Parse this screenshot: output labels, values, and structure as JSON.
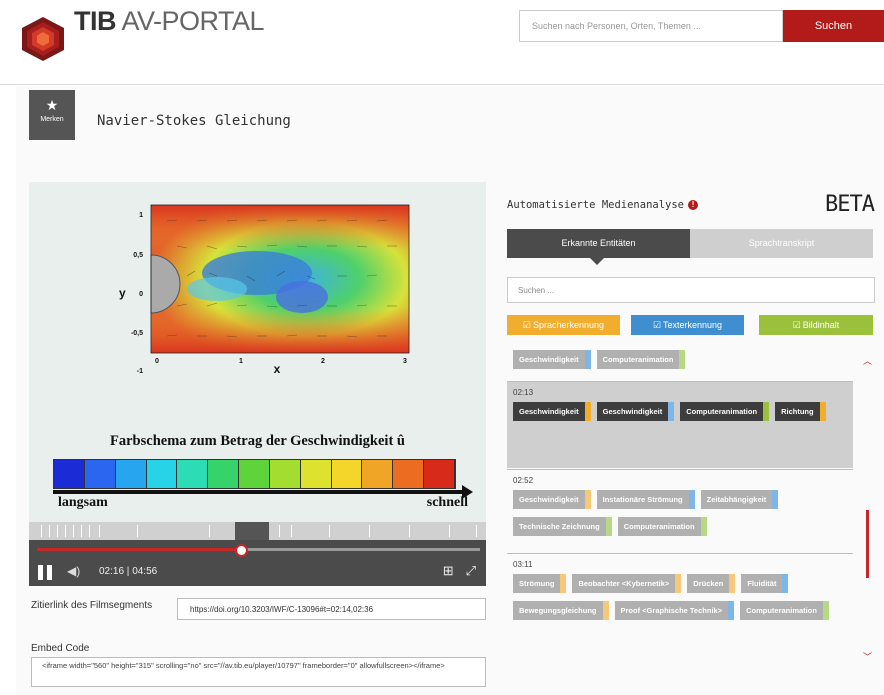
{
  "header": {
    "logo_bold": "TIB",
    "logo_light": "AV-PORTAL",
    "search_placeholder": "Suchen nach Personen, Orten, Themen ...",
    "search_button": "Suchen"
  },
  "page": {
    "merken_label": "Merken",
    "title": "Navier-Stokes Gleichung"
  },
  "video": {
    "plot": {
      "y_label": "y",
      "x_label": "x",
      "y_ticks": [
        "1",
        "0,5",
        "0",
        "-0,5",
        "-1"
      ],
      "x_ticks": [
        "0",
        "1",
        "2",
        "3"
      ]
    },
    "caption": "Farbschema zum Betrag der Geschwindigkeit û",
    "slow_label": "langsam",
    "fast_label": "schnell",
    "colorbar_colors": [
      "#1b2bd6",
      "#2b66f0",
      "#27a6ef",
      "#27d3e6",
      "#2bdcb5",
      "#35d36a",
      "#5fd43a",
      "#a2dd2f",
      "#dde22f",
      "#f4d52a",
      "#f1a526",
      "#ec6c22",
      "#d82a1b"
    ],
    "progress": 0.46,
    "current_time": "02:16",
    "duration": "04:56",
    "time_sep": " | "
  },
  "citation": {
    "label": "Zitierlink des Filmsegments",
    "value": "https://doi.org/10.3203/IWF/C-13096#t=02:14,02:36"
  },
  "embed": {
    "label": "Embed Code",
    "value": "<iframe width=\"560\" height=\"315\" scrolling=\"no\" src=\"//av.tib.eu/player/10797\" frameborder=\"0\" allowfullscreen></iframe>"
  },
  "analysis": {
    "title": "Automatisierte Medienanalyse",
    "beta": "BETA",
    "tabs": [
      "Erkannte Entitäten",
      "Sprachtranskript"
    ],
    "search_placeholder": "Suchen ...",
    "filters": [
      {
        "label": "Spracherkennung",
        "color": "#f0ad2e"
      },
      {
        "label": "Texterkennung",
        "color": "#3f8fd0"
      },
      {
        "label": "Bildinhalt",
        "color": "#9bc13c"
      }
    ],
    "groups": [
      {
        "time": "",
        "highlight": false,
        "tags": [
          {
            "label": "Geschwindigkeit",
            "bar": "#7fb6e8",
            "dark": false
          },
          {
            "label": "Computeranimation",
            "bar": "#b7d983",
            "dark": false
          }
        ]
      },
      {
        "time": "02:13",
        "highlight": true,
        "tags": [
          {
            "label": "Geschwindigkeit",
            "bar": "#f0ad2e",
            "dark": true
          },
          {
            "label": "Geschwindigkeit",
            "bar": "#7fb6e8",
            "dark": true
          },
          {
            "label": "Computeranimation",
            "bar": "#9bc13c",
            "dark": true
          },
          {
            "label": "Richtung",
            "bar": "#f0ad2e",
            "dark": true
          }
        ]
      },
      {
        "time": "02:52",
        "highlight": false,
        "tags": [
          {
            "label": "Geschwindigkeit",
            "bar": "#f5c87a",
            "dark": false
          },
          {
            "label": "Instationäre Strömung",
            "bar": "#7fb6e8",
            "dark": false
          },
          {
            "label": "Zeitabhängigkeit",
            "bar": "#7fb6e8",
            "dark": false
          },
          {
            "label": "Technische Zeichnung",
            "bar": "#b7d983",
            "dark": false
          },
          {
            "label": "Computeranimation",
            "bar": "#b7d983",
            "dark": false
          }
        ]
      },
      {
        "time": "03:11",
        "highlight": false,
        "tags": [
          {
            "label": "Strömung",
            "bar": "#f5c87a",
            "dark": false
          },
          {
            "label": "Beobachter <Kybernetik>",
            "bar": "#f5c87a",
            "dark": false
          },
          {
            "label": "Drücken",
            "bar": "#f5c87a",
            "dark": false
          },
          {
            "label": "Fluidität",
            "bar": "#7fb6e8",
            "dark": false
          },
          {
            "label": "Bewegungsgleichung",
            "bar": "#f5c87a",
            "dark": false
          },
          {
            "label": "Proof <Graphische Technik>",
            "bar": "#7fb6e8",
            "dark": false
          },
          {
            "label": "Computeranimation",
            "bar": "#b7d983",
            "dark": false
          }
        ]
      }
    ]
  }
}
